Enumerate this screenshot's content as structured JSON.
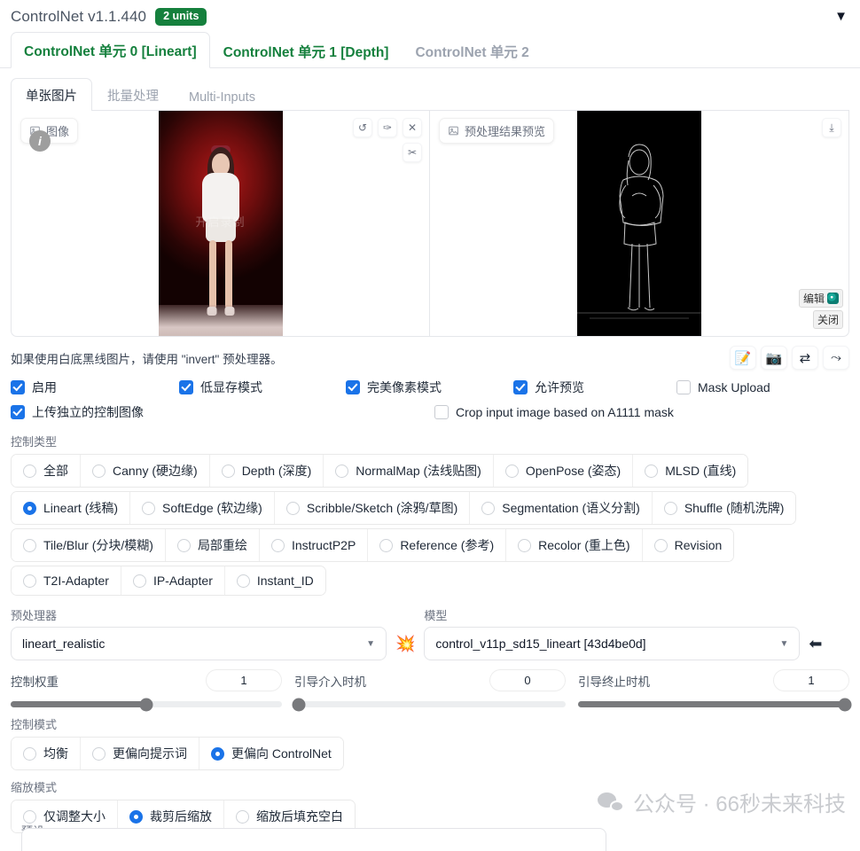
{
  "header": {
    "title": "ControlNet v1.1.440",
    "units_badge": "2 units",
    "collapse_icon": "caret-down-icon"
  },
  "unit_tabs": [
    {
      "label": "ControlNet 单元 0 [Lineart]",
      "active": true
    },
    {
      "label": "ControlNet 单元 1 [Depth]",
      "active": false
    },
    {
      "label": "ControlNet 单元 2",
      "active": false
    }
  ],
  "sub_tabs": [
    {
      "label": "单张图片",
      "active": true
    },
    {
      "label": "批量处理",
      "active": false
    },
    {
      "label": "Multi-Inputs",
      "active": false
    }
  ],
  "image_panel": {
    "left_chip_label": "图像",
    "left_chip_icon": "image-icon",
    "info_badge": "i",
    "tools": [
      {
        "name": "undo-icon",
        "glyph": "↺"
      },
      {
        "name": "eraser-icon",
        "glyph": "✑"
      },
      {
        "name": "close-icon",
        "glyph": "✕"
      },
      {
        "name": "brush-icon",
        "glyph": "✂"
      }
    ],
    "photo_watermark": "开启录制",
    "right_chip_label": "预处理结果预览",
    "right_chip_icon": "image-icon",
    "download_icon": "download-icon",
    "edit_label": "编辑",
    "edit_icon": "swirl-icon",
    "close_label": "关闭"
  },
  "hint": {
    "text": "如果使用白底黑线图片，请使用 \"invert\" 预处理器。",
    "icons": [
      {
        "name": "open-new-canvas-icon",
        "glyph": "📝"
      },
      {
        "name": "webcam-icon",
        "glyph": "📷"
      },
      {
        "name": "swap-icon",
        "glyph": "⇄"
      },
      {
        "name": "send-dimensions-icon",
        "glyph": "⤳"
      }
    ]
  },
  "checkboxes_row1": [
    {
      "label": "启用",
      "checked": true
    },
    {
      "label": "低显存模式",
      "checked": true
    },
    {
      "label": "完美像素模式",
      "checked": true
    },
    {
      "label": "允许预览",
      "checked": true
    },
    {
      "label": "Mask Upload",
      "checked": false
    }
  ],
  "checkboxes_row2": [
    {
      "label": "上传独立的控制图像",
      "checked": true
    },
    {
      "label": "Crop input image based on A1111 mask",
      "checked": false
    }
  ],
  "control_type": {
    "label": "控制类型",
    "rows": [
      [
        {
          "label": "全部",
          "selected": false
        },
        {
          "label": "Canny (硬边缘)",
          "selected": false
        },
        {
          "label": "Depth (深度)",
          "selected": false
        },
        {
          "label": "NormalMap (法线贴图)",
          "selected": false
        },
        {
          "label": "OpenPose (姿态)",
          "selected": false
        },
        {
          "label": "MLSD (直线)",
          "selected": false
        }
      ],
      [
        {
          "label": "Lineart (线稿)",
          "selected": true
        },
        {
          "label": "SoftEdge (软边缘)",
          "selected": false
        },
        {
          "label": "Scribble/Sketch (涂鸦/草图)",
          "selected": false
        },
        {
          "label": "Segmentation (语义分割)",
          "selected": false
        },
        {
          "label": "Shuffle (随机洗牌)",
          "selected": false
        }
      ],
      [
        {
          "label": "Tile/Blur (分块/模糊)",
          "selected": false
        },
        {
          "label": "局部重绘",
          "selected": false
        },
        {
          "label": "InstructP2P",
          "selected": false
        },
        {
          "label": "Reference (参考)",
          "selected": false
        },
        {
          "label": "Recolor (重上色)",
          "selected": false
        },
        {
          "label": "Revision",
          "selected": false
        }
      ],
      [
        {
          "label": "T2I-Adapter",
          "selected": false
        },
        {
          "label": "IP-Adapter",
          "selected": false
        },
        {
          "label": "Instant_ID",
          "selected": false
        }
      ]
    ]
  },
  "preprocessor": {
    "label": "预处理器",
    "value": "lineart_realistic",
    "run_icon": "explosion-icon"
  },
  "model": {
    "label": "模型",
    "value": "control_v11p_sd15_lineart [43d4be0d]",
    "side_icon": "arrow-end-icon"
  },
  "sliders": [
    {
      "name": "控制权重",
      "value": "1",
      "percent": 50
    },
    {
      "name": "引导介入时机",
      "value": "0",
      "percent": 0
    },
    {
      "name": "引导终止时机",
      "value": "1",
      "percent": 100
    }
  ],
  "control_mode": {
    "label": "控制模式",
    "options": [
      {
        "label": "均衡",
        "selected": false
      },
      {
        "label": "更偏向提示词",
        "selected": false
      },
      {
        "label": "更偏向 ControlNet",
        "selected": true
      }
    ]
  },
  "resize_mode": {
    "label": "缩放模式",
    "options": [
      {
        "label": "仅调整大小",
        "selected": false
      },
      {
        "label": "裁剪后缩放",
        "selected": true
      },
      {
        "label": "缩放后填充空白",
        "selected": false
      }
    ]
  },
  "preset": {
    "label": "预设"
  },
  "watermark": {
    "text": "公众号 · 66秒未来科技",
    "icon": "wechat-icon"
  },
  "colors": {
    "accent_green": "#15803d",
    "accent_blue": "#1a73e8",
    "border": "#e5e7eb",
    "muted_text": "#9ca3af"
  }
}
